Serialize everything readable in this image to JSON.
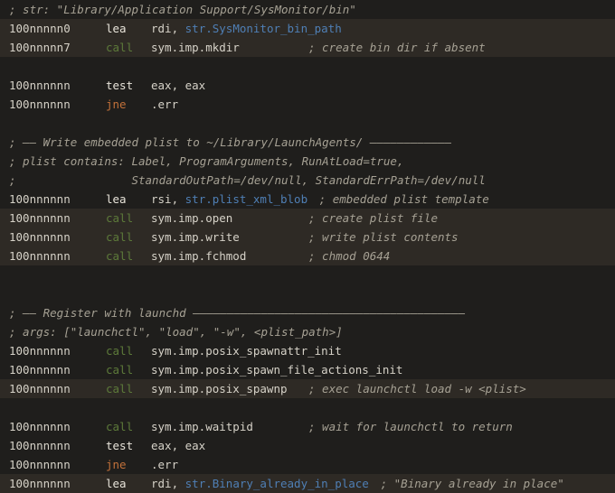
{
  "listing": {
    "lines": [
      {
        "comment": "; str: \"Library/Application Support/SysMonitor/bin\""
      },
      {
        "addr": "100nnnnn0",
        "mnemonic": "lea",
        "mclass": "lea",
        "highlight": true,
        "operands": [
          {
            "t": "rdi, "
          },
          {
            "t": "str.SysMonitor_bin_path",
            "c": "str"
          }
        ]
      },
      {
        "addr": "100nnnnn7",
        "mnemonic": "call",
        "mclass": "call",
        "highlight": true,
        "operands": [
          {
            "t": "sym.imp.mkdir"
          }
        ],
        "inline_comment": "; create bin dir if absent"
      },
      {},
      {
        "addr": "100nnnnnn",
        "mnemonic": "test",
        "mclass": "test",
        "operands": [
          {
            "t": "eax, eax"
          }
        ]
      },
      {
        "addr": "100nnnnnn",
        "mnemonic": "jne",
        "mclass": "jne",
        "operands": [
          {
            "t": ".err"
          }
        ]
      },
      {},
      {
        "comment": "; —— Write embedded plist to ~/Library/LaunchAgents/ ————————————"
      },
      {
        "comment": "; plist contains: Label, ProgramArguments, RunAtLoad=true,"
      },
      {
        "comment": ";                 StandardOutPath=/dev/null, StandardErrPath=/dev/null"
      },
      {
        "addr": "100nnnnnn",
        "mnemonic": "lea",
        "mclass": "lea",
        "operands": [
          {
            "t": "rsi, "
          },
          {
            "t": "str.plist_xml_blob",
            "c": "str"
          }
        ],
        "inline_comment": "; embedded plist template"
      },
      {
        "addr": "100nnnnnn",
        "mnemonic": "call",
        "mclass": "call",
        "highlight": true,
        "operands": [
          {
            "t": "sym.imp.open"
          }
        ],
        "inline_comment": "; create plist file"
      },
      {
        "addr": "100nnnnnn",
        "mnemonic": "call",
        "mclass": "call",
        "highlight": true,
        "operands": [
          {
            "t": "sym.imp.write"
          }
        ],
        "inline_comment": "; write plist contents"
      },
      {
        "addr": "100nnnnnn",
        "mnemonic": "call",
        "mclass": "call",
        "highlight": true,
        "operands": [
          {
            "t": "sym.imp.fchmod"
          }
        ],
        "inline_comment": "; chmod 0644"
      },
      {},
      {},
      {
        "comment": "; —— Register with launchd ————————————————————————————————————————"
      },
      {
        "comment": "; args: [\"launchctl\", \"load\", \"-w\", <plist_path>]"
      },
      {
        "addr": "100nnnnnn",
        "mnemonic": "call",
        "mclass": "call",
        "operands": [
          {
            "t": "sym.imp.posix_spawnattr_init"
          }
        ]
      },
      {
        "addr": "100nnnnnn",
        "mnemonic": "call",
        "mclass": "call",
        "operands": [
          {
            "t": "sym.imp.posix_spawn_file_actions_init"
          }
        ]
      },
      {
        "addr": "100nnnnnn",
        "mnemonic": "call",
        "mclass": "call",
        "highlight": true,
        "operands": [
          {
            "t": "sym.imp.posix_spawnp"
          }
        ],
        "inline_comment": "; exec launchctl load -w <plist>"
      },
      {},
      {
        "addr": "100nnnnnn",
        "mnemonic": "call",
        "mclass": "call",
        "operands": [
          {
            "t": "sym.imp.waitpid"
          }
        ],
        "inline_comment": "; wait for launchctl to return"
      },
      {
        "addr": "100nnnnnn",
        "mnemonic": "test",
        "mclass": "test",
        "operands": [
          {
            "t": "eax, eax"
          }
        ]
      },
      {
        "addr": "100nnnnnn",
        "mnemonic": "jne",
        "mclass": "jne",
        "operands": [
          {
            "t": ".err"
          }
        ]
      },
      {
        "addr": "100nnnnnn",
        "mnemonic": "lea",
        "mclass": "lea",
        "highlight": true,
        "operands": [
          {
            "t": "rdi, "
          },
          {
            "t": "str.Binary_already_in_place",
            "c": "str"
          }
        ],
        "inline_comment": "; \"Binary already in place\""
      }
    ]
  }
}
